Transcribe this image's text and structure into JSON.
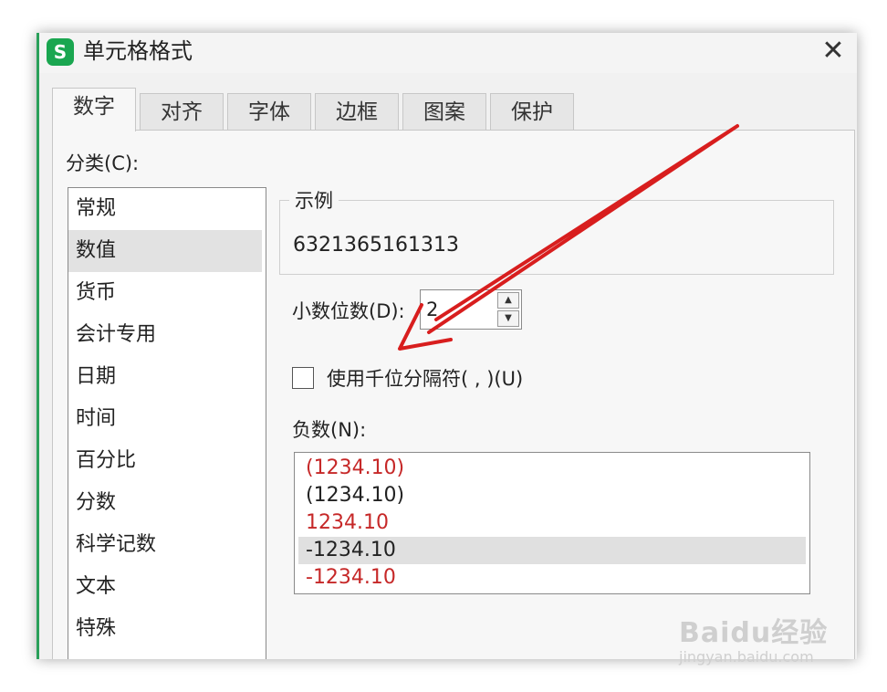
{
  "title": "单元格格式",
  "app_icon_letter": "S",
  "close_glyph": "✕",
  "tabs": [
    {
      "label": "数字",
      "active": true
    },
    {
      "label": "对齐"
    },
    {
      "label": "字体"
    },
    {
      "label": "边框"
    },
    {
      "label": "图案"
    },
    {
      "label": "保护"
    }
  ],
  "category_label": "分类(C):",
  "categories": [
    "常规",
    "数值",
    "货币",
    "会计专用",
    "日期",
    "时间",
    "百分比",
    "分数",
    "科学记数",
    "文本",
    "特殊"
  ],
  "selected_category": "数值",
  "sample": {
    "label": "示例",
    "value": "6321365161313"
  },
  "decimal": {
    "label": "小数位数(D):",
    "value": "2"
  },
  "thousands_separator": {
    "label": "使用千位分隔符( , )(U)",
    "checked": false
  },
  "negative": {
    "label": "负数(N):",
    "items": [
      {
        "text": "(1234.10)",
        "red": true
      },
      {
        "text": "(1234.10)",
        "red": false
      },
      {
        "text": "1234.10",
        "red": true
      },
      {
        "text": "-1234.10",
        "red": false,
        "selected": true
      },
      {
        "text": "-1234.10",
        "red": true
      }
    ]
  },
  "annotation_color": "#d81e1e",
  "watermark": {
    "logo": "Baidu经验",
    "sub": "jingyan.baidu.com"
  }
}
